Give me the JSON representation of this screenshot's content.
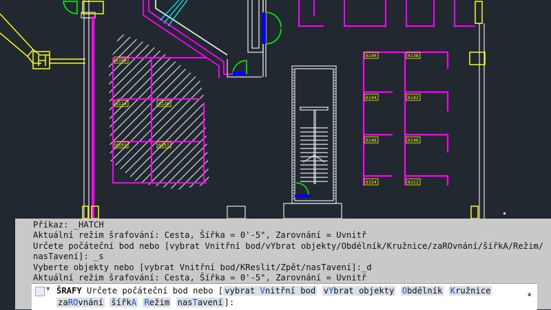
{
  "cad": {
    "room_tags": [
      "6140",
      "6138",
      "6144",
      "6142",
      "6146",
      "6146",
      "6154",
      "6152",
      "6108",
      "6124",
      "6120",
      "6103",
      "6107"
    ],
    "colors": {
      "background": "#212830",
      "walls": "#ff00ff",
      "doors": "#00ff00",
      "tags": "#ffff00",
      "lines": "#e6e6e6",
      "hatch": "#dcdcdc",
      "cyan": "#00ffff",
      "blue": "#0000ff"
    }
  },
  "command_line": {
    "history": [
      "Příkaz: _HATCH",
      "Aktuální režim šrafování: Cesta, Šířka = 0'-5\", Zarovnání = Uvnitř",
      "Určete počáteční bod nebo [vybrat Vnitřní bod/vYbrat objekty/Obdélník/Kružnice/zaROvnání/šířkA/Režim/",
      "nasTavení]: _s",
      "Vyberte objekty nebo [vybrat Vnitřní bod/KReslit/Zpět/nasTavení]:_d",
      "Aktuální režim šrafování: Cesta, Šířka = 0'-5\", Zarovnání = Uvnitř"
    ],
    "current": {
      "command": "ŠRAFY",
      "prompt": "Určete počáteční bod nebo [",
      "options": [
        {
          "pre": "vybrat ",
          "hot": "V",
          "post": "nitřní bod"
        },
        {
          "pre": "v",
          "hot": "Y",
          "post": "brat objekty"
        },
        {
          "pre": "",
          "hot": "O",
          "post": "bdélník"
        },
        {
          "pre": "",
          "hot": "K",
          "post": "ružnice"
        },
        {
          "pre": "za",
          "hot": "RO",
          "post": "vnání"
        },
        {
          "pre": "šířk",
          "hot": "A",
          "post": ""
        },
        {
          "pre": "",
          "hot": "R",
          "post": "ežim"
        },
        {
          "pre": "nas",
          "hot": "T",
          "post": "avení"
        }
      ],
      "suffix": "]:"
    },
    "icons": {
      "grip": "grip-icon",
      "close": "close-icon",
      "customize": "wrench-icon",
      "recent": "command-recent-icon",
      "dropdown": "chevron-down-icon",
      "scroll": "chevron-up-icon"
    }
  }
}
